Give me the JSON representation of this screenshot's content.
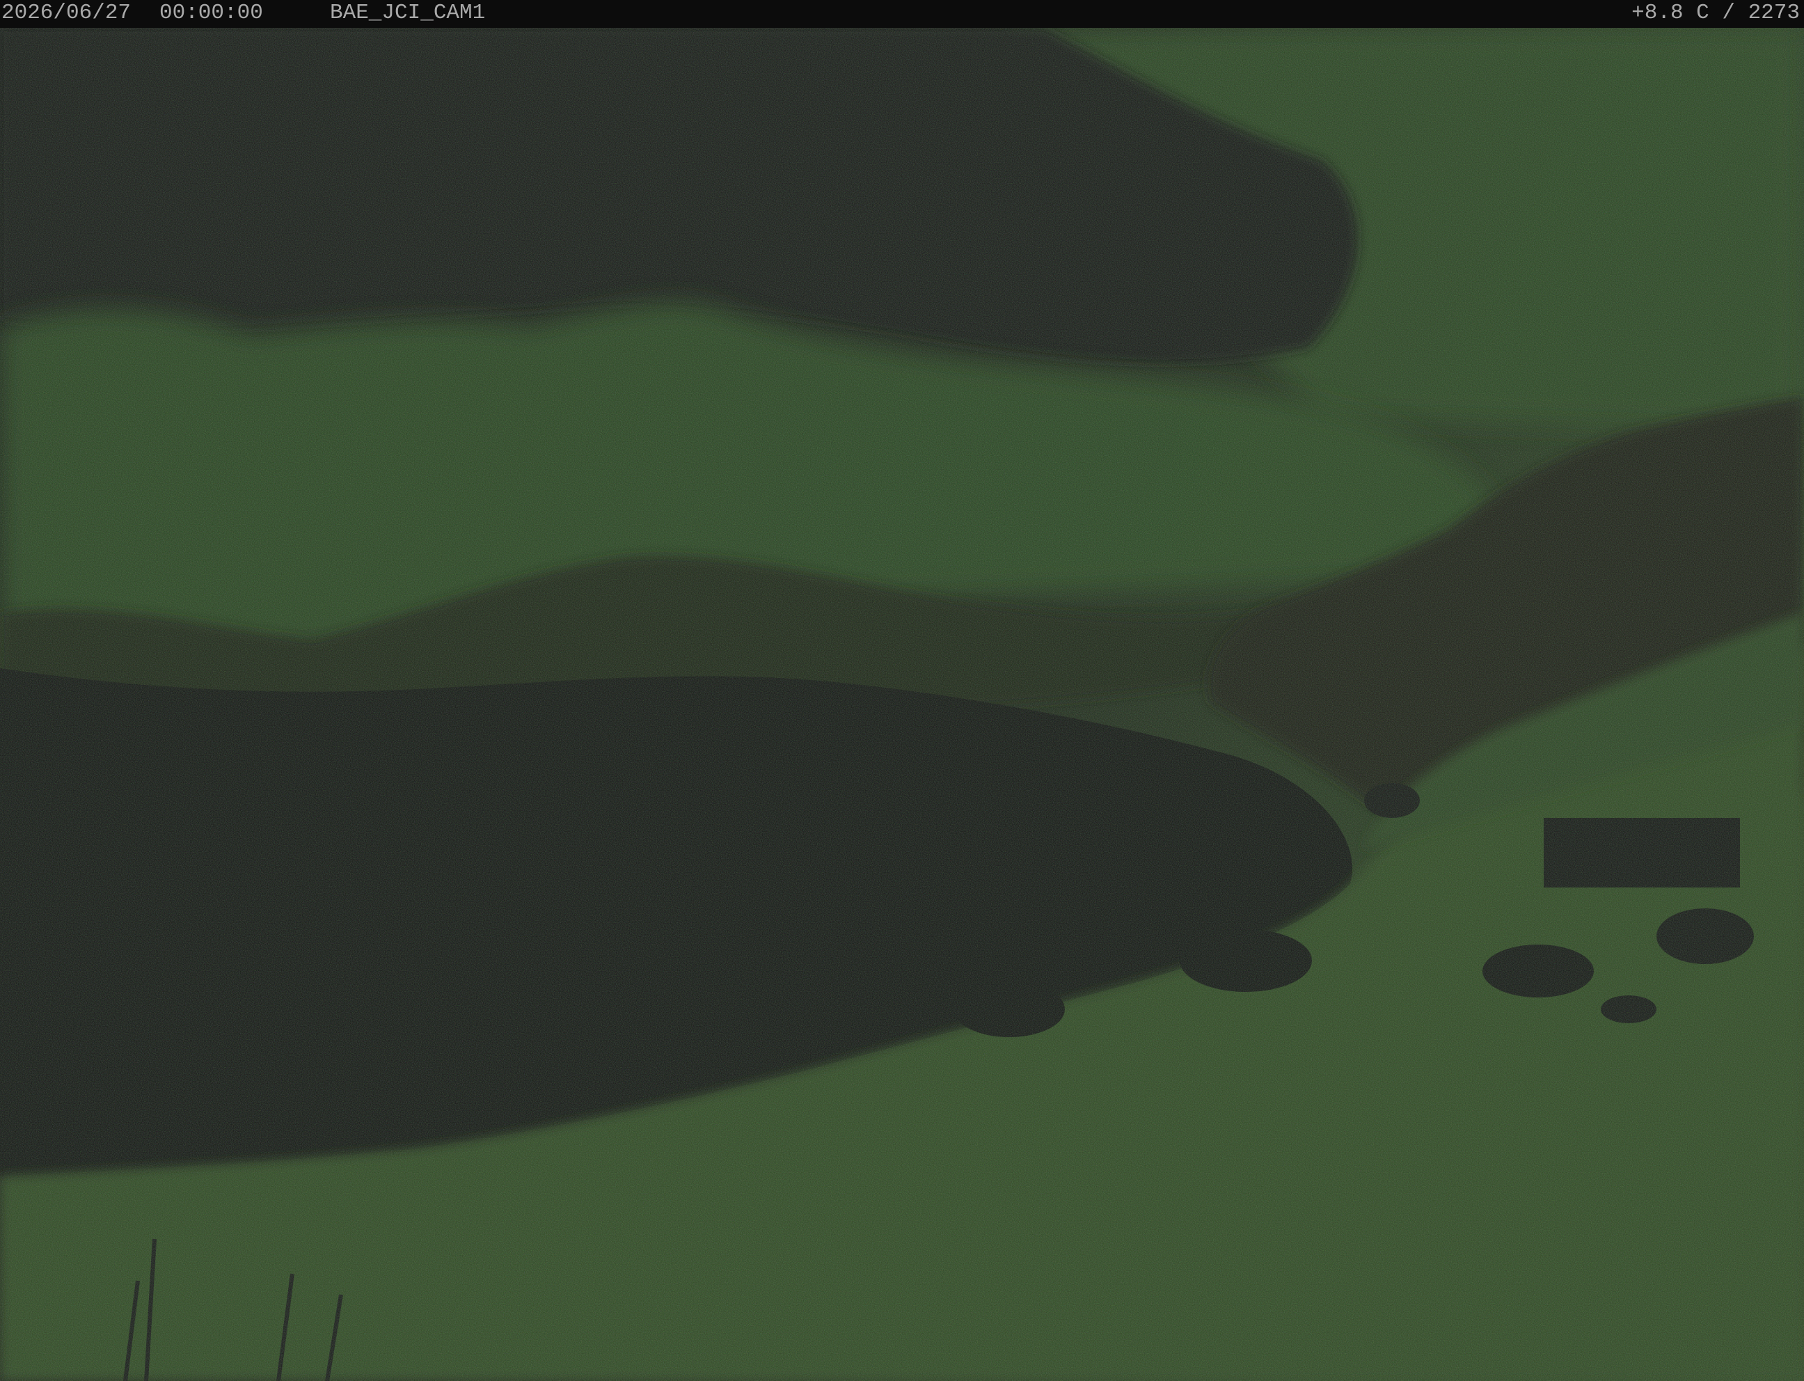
{
  "overlay": {
    "date": "2026/06/27",
    "time": "00:00:00",
    "camera_id": "BAE_JCI_CAM1",
    "temperature_altitude": "+8.8 C / 2273"
  },
  "colors": {
    "background": "#131313",
    "overlay_bar": "#0c0c0c",
    "overlay_text": "#a9a9a9",
    "terrain_green": "#2f4a24",
    "cloud_dark": "#161616",
    "shadow": "#121212"
  }
}
